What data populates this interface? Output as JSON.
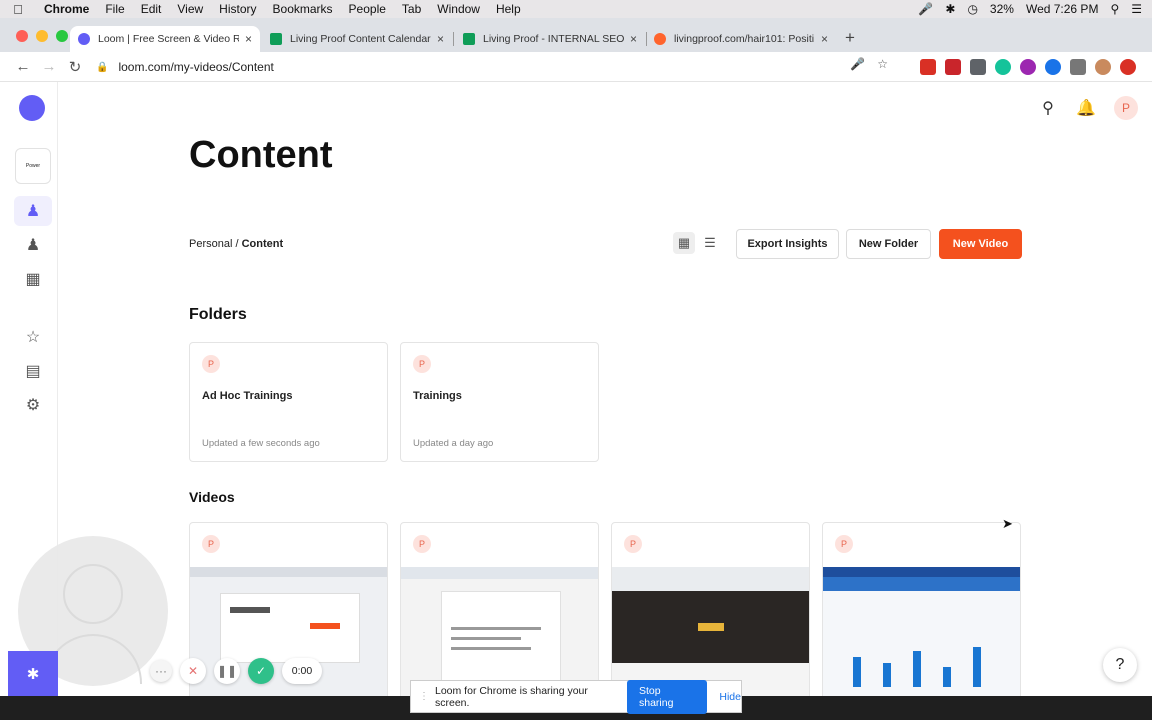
{
  "menubar": {
    "app": "Chrome",
    "items": [
      "File",
      "Edit",
      "View",
      "History",
      "Bookmarks",
      "People",
      "Tab",
      "Window",
      "Help"
    ],
    "battery": "32%",
    "clock": "Wed 7:26 PM"
  },
  "tabs": [
    {
      "label": "Loom | Free Screen & Video Re",
      "icon": "loom-icon",
      "color": "#625df5"
    },
    {
      "label": "Living Proof Content Calendar",
      "icon": "sheets-icon",
      "color": "#0f9d58"
    },
    {
      "label": "Living Proof - INTERNAL SEO &",
      "icon": "sheets-icon",
      "color": "#0f9d58"
    },
    {
      "label": "livingproof.com/hair101: Positi",
      "icon": "semrush-icon",
      "color": "#ff642d"
    }
  ],
  "tab_close": "×",
  "new_tab": "+",
  "address": {
    "url": "loom.com/my-videos/Content"
  },
  "page": {
    "title": "Content",
    "breadcrumb": {
      "parent": "Personal",
      "separator": "/",
      "current": "Content"
    },
    "buttons": {
      "export": "Export Insights",
      "new_folder": "New Folder",
      "new_video": "New Video"
    },
    "avatar_initial": "P",
    "workspace_label": "Power",
    "folders_heading": "Folders",
    "videos_heading": "Videos",
    "folders": [
      {
        "name": "Ad Hoc Trainings",
        "updated": "Updated a few seconds ago",
        "owner": "P"
      },
      {
        "name": "Trainings",
        "updated": "Updated a day ago",
        "owner": "P"
      }
    ],
    "videos": [
      {
        "owner": "P",
        "bg": "#eef0f3"
      },
      {
        "owner": "P",
        "bg": "#f3f3f3"
      },
      {
        "owner": "P",
        "bg": "#3b3532"
      },
      {
        "owner": "P",
        "bg": "#f5f7fa"
      }
    ]
  },
  "recorder": {
    "timer": "0:00",
    "more": "···"
  },
  "sharebar": {
    "message": "Loom for Chrome is sharing your screen.",
    "stop": "Stop sharing",
    "hide": "Hide"
  },
  "help_label": "?",
  "colors": {
    "brand": "#625df5",
    "primary_button": "#f4511e",
    "avatar_bg": "#fde2dd"
  }
}
